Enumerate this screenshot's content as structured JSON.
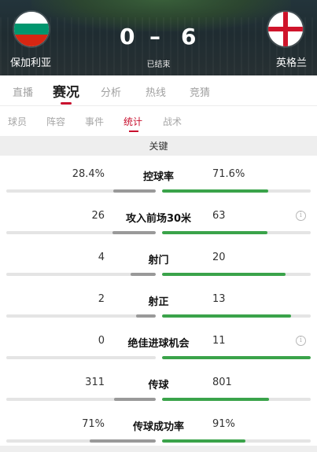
{
  "match": {
    "home_team": "保加利亚",
    "away_team": "英格兰",
    "home_score": "0",
    "separator": "–",
    "away_score": "6",
    "status": "已结束"
  },
  "main_tabs": [
    {
      "label": "直播",
      "active": false
    },
    {
      "label": "赛况",
      "active": true
    },
    {
      "label": "分析",
      "active": false
    },
    {
      "label": "热线",
      "active": false
    },
    {
      "label": "竞猜",
      "active": false
    }
  ],
  "sub_tabs": [
    {
      "label": "球员",
      "active": false
    },
    {
      "label": "阵容",
      "active": false
    },
    {
      "label": "事件",
      "active": false
    },
    {
      "label": "统计",
      "active": true
    },
    {
      "label": "战术",
      "active": false
    }
  ],
  "section_title": "关键",
  "info_symbol": "i",
  "stats": [
    {
      "label": "控球率",
      "home": "28.4%",
      "away": "71.6%",
      "home_share": 0.284,
      "away_share": 0.716,
      "info": false
    },
    {
      "label": "攻入前场30米",
      "home": "26",
      "away": "63",
      "home_share": 0.292,
      "away_share": 0.708,
      "info": true
    },
    {
      "label": "射门",
      "home": "4",
      "away": "20",
      "home_share": 0.167,
      "away_share": 0.833,
      "info": false
    },
    {
      "label": "射正",
      "home": "2",
      "away": "13",
      "home_share": 0.133,
      "away_share": 0.867,
      "info": false
    },
    {
      "label": "绝佳进球机会",
      "home": "0",
      "away": "11",
      "home_share": 0.0,
      "away_share": 1.0,
      "info": true
    },
    {
      "label": "传球",
      "home": "311",
      "away": "801",
      "home_share": 0.28,
      "away_share": 0.72,
      "info": false
    },
    {
      "label": "传球成功率",
      "home": "71%",
      "away": "91%",
      "home_share": 0.44,
      "away_share": 0.56,
      "info": false
    }
  ],
  "colors": {
    "accent_red": "#c8102e",
    "home_bar": "#999999",
    "away_bar": "#3aa34a"
  }
}
